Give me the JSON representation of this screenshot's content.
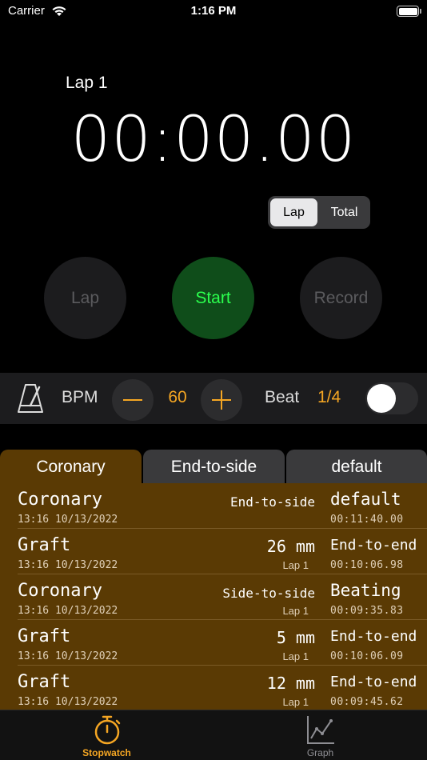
{
  "status_bar": {
    "carrier": "Carrier",
    "time": "1:16 PM"
  },
  "timer": {
    "lap_label": "Lap 1",
    "display": "00:00.00"
  },
  "mode_toggle": {
    "options": [
      "Lap",
      "Total"
    ],
    "selected": "Lap"
  },
  "controls": {
    "lap": "Lap",
    "start": "Start",
    "record": "Record"
  },
  "metronome": {
    "bpm_label": "BPM",
    "bpm_value": "60",
    "beat_label": "Beat",
    "beat_value": "1/4",
    "enabled": false
  },
  "tabs": [
    {
      "label": "Coronary",
      "selected": true
    },
    {
      "label": "End-to-side",
      "selected": false
    },
    {
      "label": "default",
      "selected": false
    }
  ],
  "records": [
    {
      "title": "Coronary",
      "timestamp": "13:16 10/13/2022",
      "mid": "End-to-side",
      "lap": "",
      "right": "default",
      "duration": "00:11:40.00"
    },
    {
      "title": "Graft",
      "timestamp": "13:16 10/13/2022",
      "mid": "26 mm",
      "lap": "Lap 1",
      "right": "End-to-end",
      "duration": "00:10:06.98"
    },
    {
      "title": "Coronary",
      "timestamp": "13:16 10/13/2022",
      "mid": "Side-to-side",
      "lap": "Lap 1",
      "right": "Beating",
      "duration": "00:09:35.83"
    },
    {
      "title": "Graft",
      "timestamp": "13:16 10/13/2022",
      "mid": "5 mm",
      "lap": "Lap 1",
      "right": "End-to-end",
      "duration": "00:10:06.09"
    },
    {
      "title": "Graft",
      "timestamp": "13:16 10/13/2022",
      "mid": "12 mm",
      "lap": "Lap 1",
      "right": "End-to-end",
      "duration": "00:09:45.62"
    }
  ],
  "tabbar": {
    "stopwatch": "Stopwatch",
    "graph": "Graph"
  },
  "colors": {
    "accent": "#f5a623",
    "start_green": "#2bff4e",
    "list_bg": "#5a3a04"
  }
}
